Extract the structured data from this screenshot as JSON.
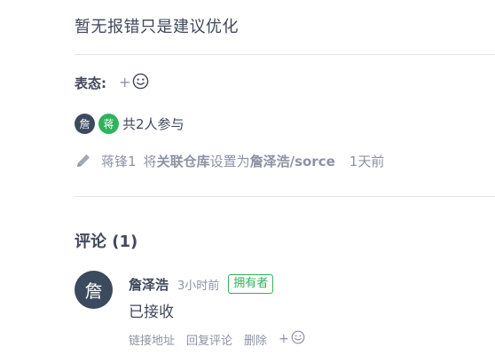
{
  "issue": {
    "description": "暂无报错只是建议优化"
  },
  "reactions": {
    "label": "表态:",
    "add_symbol": "+",
    "icon": "smiley-icon"
  },
  "participants": {
    "avatars": [
      {
        "char": "詹",
        "color": "#3b4a5e"
      },
      {
        "char": "蒋",
        "color": "#2fb25b"
      }
    ],
    "summary": "共2人参与"
  },
  "activity": {
    "icon": "pencil-icon",
    "actor": "蒋锋1",
    "action_prefix": "将",
    "field": "关联仓库",
    "action_mid": "设置为",
    "target": "詹泽浩/sorce",
    "time": "1天前"
  },
  "comments": {
    "title": "评论 (1)",
    "items": [
      {
        "avatar_char": "詹",
        "author": "詹泽浩",
        "time": "3小时前",
        "badge": "拥有者",
        "body": "已接收",
        "actions": {
          "link": "链接地址",
          "reply": "回复评论",
          "delete": "删除",
          "add_symbol": "+"
        }
      }
    ]
  },
  "colors": {
    "text": "#40485b",
    "muted": "#8c92a4",
    "green": "#2fb25b",
    "avatar_dark": "#3b4a5e",
    "divider": "#e3e5e8"
  }
}
